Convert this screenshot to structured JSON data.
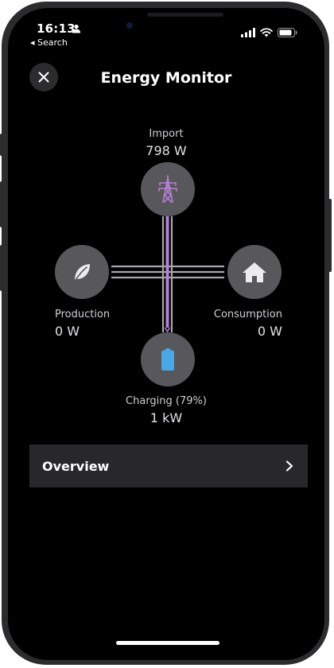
{
  "status_bar": {
    "time": "16:13",
    "back_label": "◂ Search"
  },
  "header": {
    "title": "Energy Monitor"
  },
  "nodes": {
    "import": {
      "label": "Import",
      "value": "798 W",
      "icon": "power-tower-icon"
    },
    "production": {
      "label": "Production",
      "value": "0 W",
      "icon": "leaf-icon"
    },
    "consumption": {
      "label": "Consumption",
      "value": "0 W",
      "icon": "house-icon"
    },
    "charging": {
      "label": "Charging (79%)",
      "value": "1 kW",
      "icon": "battery-icon"
    }
  },
  "overview": {
    "label": "Overview"
  },
  "colors": {
    "background": "#000000",
    "node": "#58585c",
    "flow_active": "#b77fd6",
    "battery": "#4aa8e8",
    "card": "#28282b"
  }
}
